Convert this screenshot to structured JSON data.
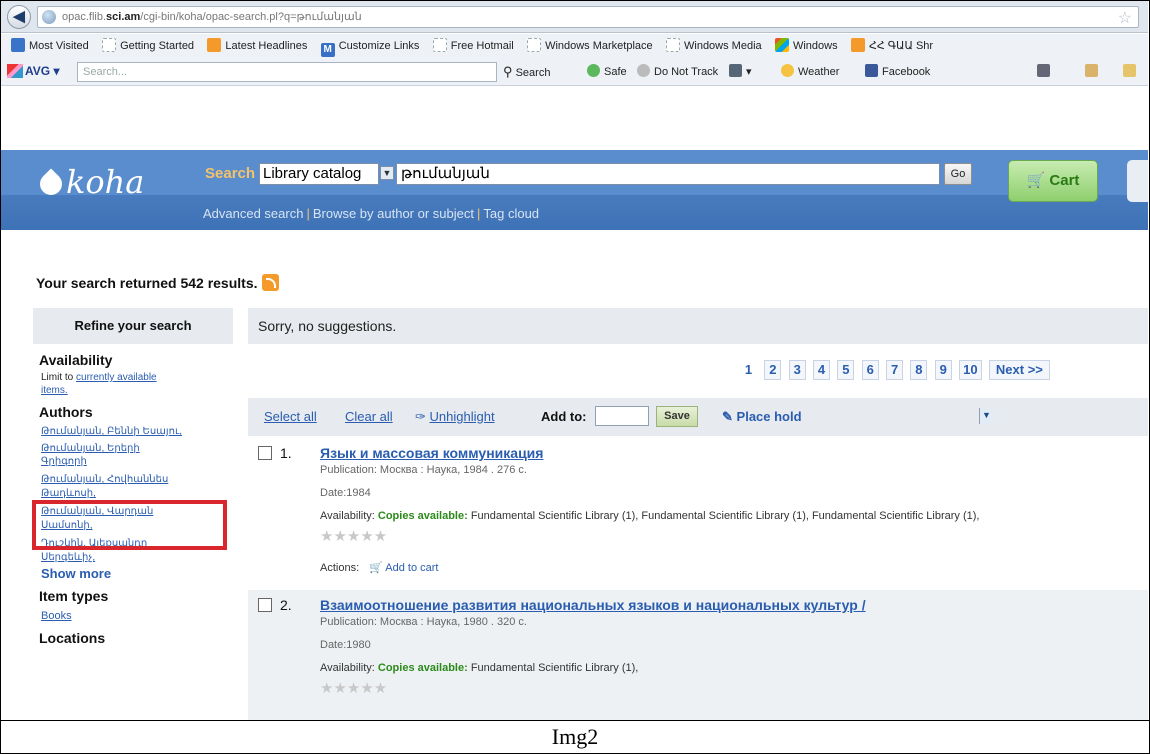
{
  "browser": {
    "url_host": "opac.flib.",
    "url_bold": "sci.am",
    "url_rest": "/cgi-bin/koha/opac-search.pl?q=թումանյան",
    "bookmarks": [
      {
        "icon": "globe-icon",
        "label": "Most Visited"
      },
      {
        "icon": "page-icon",
        "label": "Getting Started"
      },
      {
        "icon": "rss-icon",
        "label": "Latest Headlines"
      },
      {
        "icon": "m-icon",
        "label": "Customize Links"
      },
      {
        "icon": "page-icon",
        "label": "Free Hotmail"
      },
      {
        "icon": "page-icon",
        "label": "Windows Marketplace"
      },
      {
        "icon": "page-icon",
        "label": "Windows Media"
      },
      {
        "icon": "windows-icon",
        "label": "Windows"
      },
      {
        "icon": "rss-icon",
        "label": "ՀՀ ԳԱԱ Shr"
      }
    ],
    "avg_label": "AVG",
    "avg_search_placeholder": "Search...",
    "toolbar": {
      "search": "Search",
      "safe": "Safe",
      "dnt": "Do Not Track",
      "weather": "Weather",
      "facebook": "Facebook"
    }
  },
  "koha": {
    "logo": "koha",
    "search_label": "Search",
    "catalog_option": "Library catalog",
    "query": "թումանյան",
    "go_label": "Go",
    "cart_label": "Cart",
    "links": {
      "advanced": "Advanced search",
      "browse": "Browse by author or subject",
      "tags": "Tag cloud"
    }
  },
  "results": {
    "summary": "Your search returned 542 results.",
    "no_suggestions": "Sorry, no suggestions."
  },
  "sidebar": {
    "refine": "Refine your search",
    "availability_head": "Availability",
    "limit_to": "Limit to",
    "limit_link_1": "currently available",
    "limit_link_2": "items.",
    "authors_head": "Authors",
    "authors": [
      "Թումանյան, Բեննի Եսայու,",
      "Թումանյան, Երերի",
      "Գրիգորի",
      "Թումանյան, Հովհաննես",
      "Թադևոսի,",
      "Թումանյան, Վարդան",
      "Սամսոնի,",
      "Դուշկին, Ալեքսանդր",
      "Սերգեևիչ,"
    ],
    "show_more": "Show more",
    "item_types_head": "Item types",
    "books": "Books",
    "locations_head": "Locations"
  },
  "pagination": {
    "current": "1",
    "pages": [
      "2",
      "3",
      "4",
      "5",
      "6",
      "7",
      "8",
      "9",
      "10"
    ],
    "next": "Next >>"
  },
  "action_bar": {
    "select_all": "Select all",
    "clear_all": "Clear all",
    "unhighlight": "Unhighlight",
    "add_to": "Add to:",
    "save": "Save",
    "place_hold": "Place hold"
  },
  "records": [
    {
      "number": "1.",
      "title": "Язык и массовая коммуникация",
      "publication": "Publication: Москва : Наука, 1984 . 276 с.",
      "date": "Date:1984",
      "availability_label": "Availability:",
      "copies": "Copies available:",
      "libraries": "Fundamental Scientific Library (1), Fundamental Scientific Library (1), Fundamental Scientific Library (1),",
      "actions_label": "Actions:",
      "add_to_cart": "Add to cart"
    },
    {
      "number": "2.",
      "title": "Взаимоотношение развития национальных языков и национальных культур /",
      "publication": "Publication: Москва : Наука, 1980 . 320 с.",
      "date": "Date:1980",
      "availability_label": "Availability:",
      "copies": "Copies available:",
      "libraries": "Fundamental Scientific Library (1),"
    }
  ],
  "caption": "Img2"
}
